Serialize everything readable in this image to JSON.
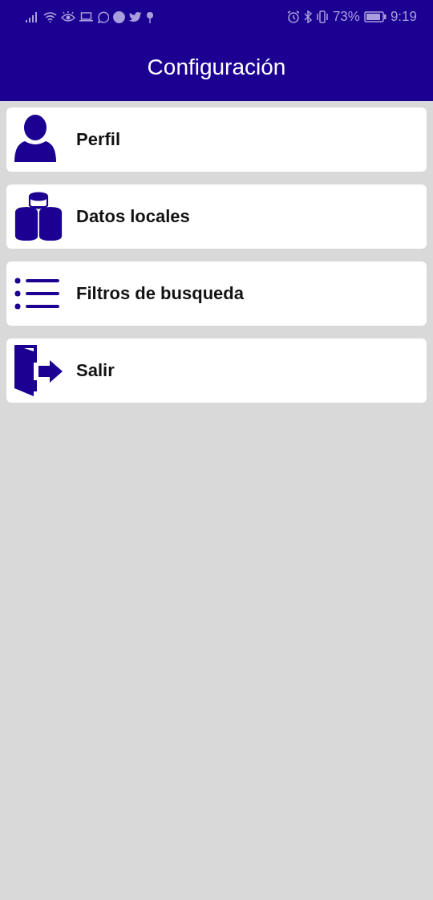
{
  "status_bar": {
    "battery": "73%",
    "time": "9:19"
  },
  "app_bar": {
    "title": "Configuración"
  },
  "items": [
    {
      "label": "Perfil",
      "kind": "profile"
    },
    {
      "label": "Datos locales",
      "kind": "database"
    },
    {
      "label": "Filtros de busqueda",
      "kind": "list"
    },
    {
      "label": "Salir",
      "kind": "exit"
    }
  ]
}
